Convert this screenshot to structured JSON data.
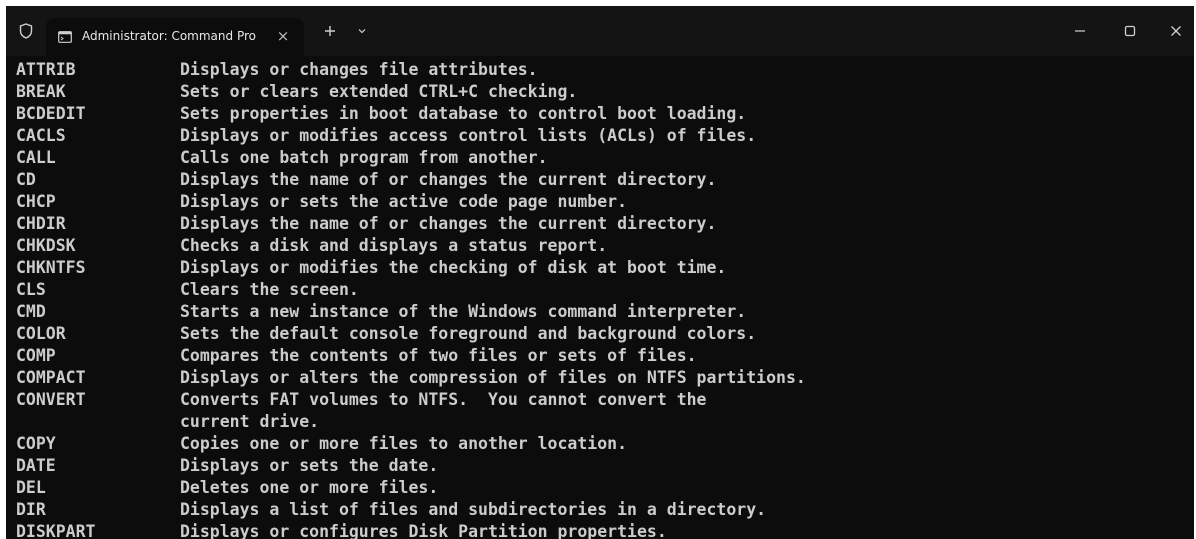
{
  "window": {
    "tab_title": "Administrator: Command Pro",
    "tab_close_glyph": "×",
    "new_tab_glyph": "+",
    "dropdown_glyph": "⌄",
    "icons": [
      "shield-icon",
      "terminal-tab-icon",
      "close-icon",
      "plus-icon",
      "chevron-down-icon",
      "minimize-icon",
      "maximize-icon",
      "window-close-icon"
    ]
  },
  "colors": {
    "background": "#0c0c0c",
    "titlebar": "#141414",
    "text": "#cccccc"
  },
  "terminal": {
    "lines": [
      {
        "cmd": "ATTRIB",
        "desc": "Displays or changes file attributes."
      },
      {
        "cmd": "BREAK",
        "desc": "Sets or clears extended CTRL+C checking."
      },
      {
        "cmd": "BCDEDIT",
        "desc": "Sets properties in boot database to control boot loading."
      },
      {
        "cmd": "CACLS",
        "desc": "Displays or modifies access control lists (ACLs) of files."
      },
      {
        "cmd": "CALL",
        "desc": "Calls one batch program from another."
      },
      {
        "cmd": "CD",
        "desc": "Displays the name of or changes the current directory."
      },
      {
        "cmd": "CHCP",
        "desc": "Displays or sets the active code page number."
      },
      {
        "cmd": "CHDIR",
        "desc": "Displays the name of or changes the current directory."
      },
      {
        "cmd": "CHKDSK",
        "desc": "Checks a disk and displays a status report."
      },
      {
        "cmd": "CHKNTFS",
        "desc": "Displays or modifies the checking of disk at boot time."
      },
      {
        "cmd": "CLS",
        "desc": "Clears the screen."
      },
      {
        "cmd": "CMD",
        "desc": "Starts a new instance of the Windows command interpreter."
      },
      {
        "cmd": "COLOR",
        "desc": "Sets the default console foreground and background colors."
      },
      {
        "cmd": "COMP",
        "desc": "Compares the contents of two files or sets of files."
      },
      {
        "cmd": "COMPACT",
        "desc": "Displays or alters the compression of files on NTFS partitions."
      },
      {
        "cmd": "CONVERT",
        "desc": "Converts FAT volumes to NTFS.  You cannot convert the"
      },
      {
        "cmd": "",
        "desc": "current drive."
      },
      {
        "cmd": "COPY",
        "desc": "Copies one or more files to another location."
      },
      {
        "cmd": "DATE",
        "desc": "Displays or sets the date."
      },
      {
        "cmd": "DEL",
        "desc": "Deletes one or more files."
      },
      {
        "cmd": "DIR",
        "desc": "Displays a list of files and subdirectories in a directory."
      },
      {
        "cmd": "DISKPART",
        "desc": "Displays or configures Disk Partition properties."
      }
    ]
  }
}
